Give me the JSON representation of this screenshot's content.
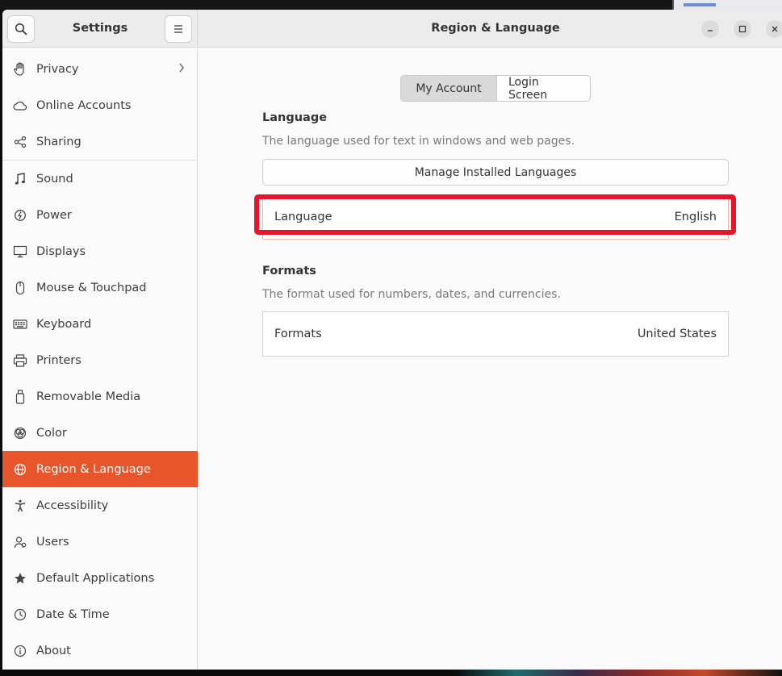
{
  "app": {
    "sidebar_title": "Settings",
    "page_title": "Region & Language"
  },
  "sidebar": {
    "items": [
      {
        "label": "Privacy",
        "icon": "hand-icon",
        "has_chevron": true
      },
      {
        "label": "Online Accounts",
        "icon": "cloud-icon"
      },
      {
        "label": "Sharing",
        "icon": "share-icon"
      },
      {
        "label": "Sound",
        "icon": "music-note-icon"
      },
      {
        "label": "Power",
        "icon": "power-icon"
      },
      {
        "label": "Displays",
        "icon": "display-icon"
      },
      {
        "label": "Mouse & Touchpad",
        "icon": "mouse-icon"
      },
      {
        "label": "Keyboard",
        "icon": "keyboard-icon"
      },
      {
        "label": "Printers",
        "icon": "printer-icon"
      },
      {
        "label": "Removable Media",
        "icon": "usb-icon"
      },
      {
        "label": "Color",
        "icon": "color-icon"
      },
      {
        "label": "Region & Language",
        "icon": "globe-icon",
        "active": true
      },
      {
        "label": "Accessibility",
        "icon": "accessibility-icon"
      },
      {
        "label": "Users",
        "icon": "users-icon"
      },
      {
        "label": "Default Applications",
        "icon": "star-icon"
      },
      {
        "label": "Date & Time",
        "icon": "clock-icon"
      },
      {
        "label": "About",
        "icon": "info-icon"
      }
    ]
  },
  "tabs": {
    "my_account": "My Account",
    "login_screen": "Login Screen"
  },
  "language": {
    "heading": "Language",
    "description": "The language used for text in windows and web pages.",
    "manage_button": "Manage Installed Languages",
    "row_label": "Language",
    "row_value": "English"
  },
  "formats": {
    "heading": "Formats",
    "description": "The format used for numbers, dates, and currencies.",
    "row_label": "Formats",
    "row_value": "United States"
  },
  "colors": {
    "accent": "#e9552a",
    "highlight": "#e8142b"
  }
}
